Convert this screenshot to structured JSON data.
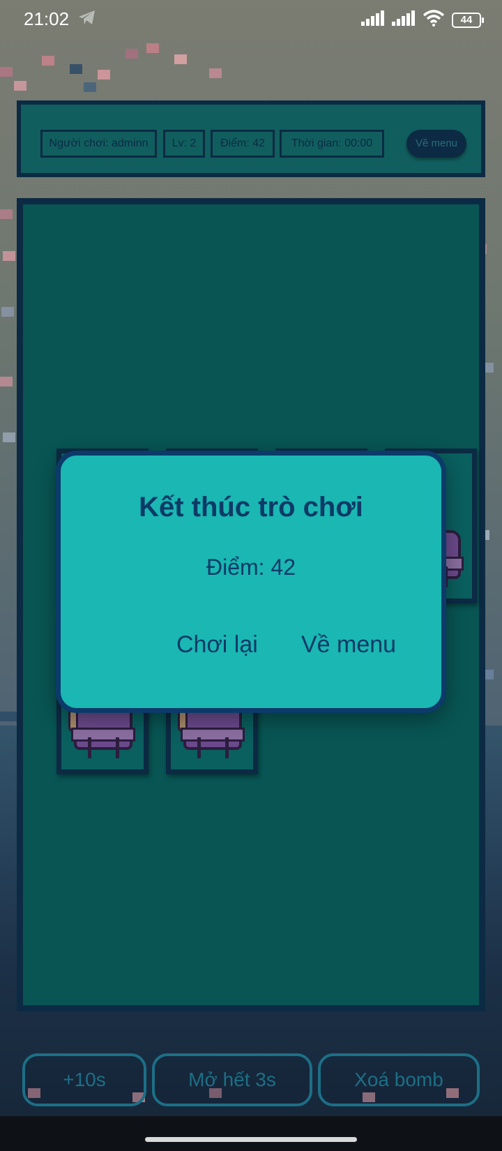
{
  "status_bar": {
    "time": "21:02",
    "battery": "44",
    "icons": [
      "telegram-icon",
      "signal-icon",
      "signal-icon",
      "wifi-icon",
      "battery-icon"
    ]
  },
  "header": {
    "player": "Người chơi: adminn",
    "level": "Lv: 2",
    "score": "Điểm: 42",
    "time": "Thời gian: 00:00",
    "menu_button": "Về menu"
  },
  "board": {
    "cards": [
      {
        "icon": "backpack-icon"
      },
      {
        "icon": "backpack-icon"
      },
      {
        "icon": "backpack-icon"
      },
      {
        "icon": "backpack-icon"
      },
      {
        "icon": "backpack-icon"
      },
      {
        "icon": "backpack-icon"
      }
    ]
  },
  "dialog": {
    "title": "Kết thúc trò chơi",
    "score": "Điểm: 42",
    "replay_button": "Chơi lại",
    "menu_button": "Về menu"
  },
  "powerups": {
    "add_time": "+10s",
    "reveal_all": "Mở hết 3s",
    "remove_bomb": "Xoá bomb"
  },
  "colors": {
    "panel_border": "#0c2a43",
    "board_bg": "#085554",
    "dialog_bg": "#1ab7b3",
    "dialog_text": "#0d3a67",
    "powerup_border": "#1c6f86"
  }
}
